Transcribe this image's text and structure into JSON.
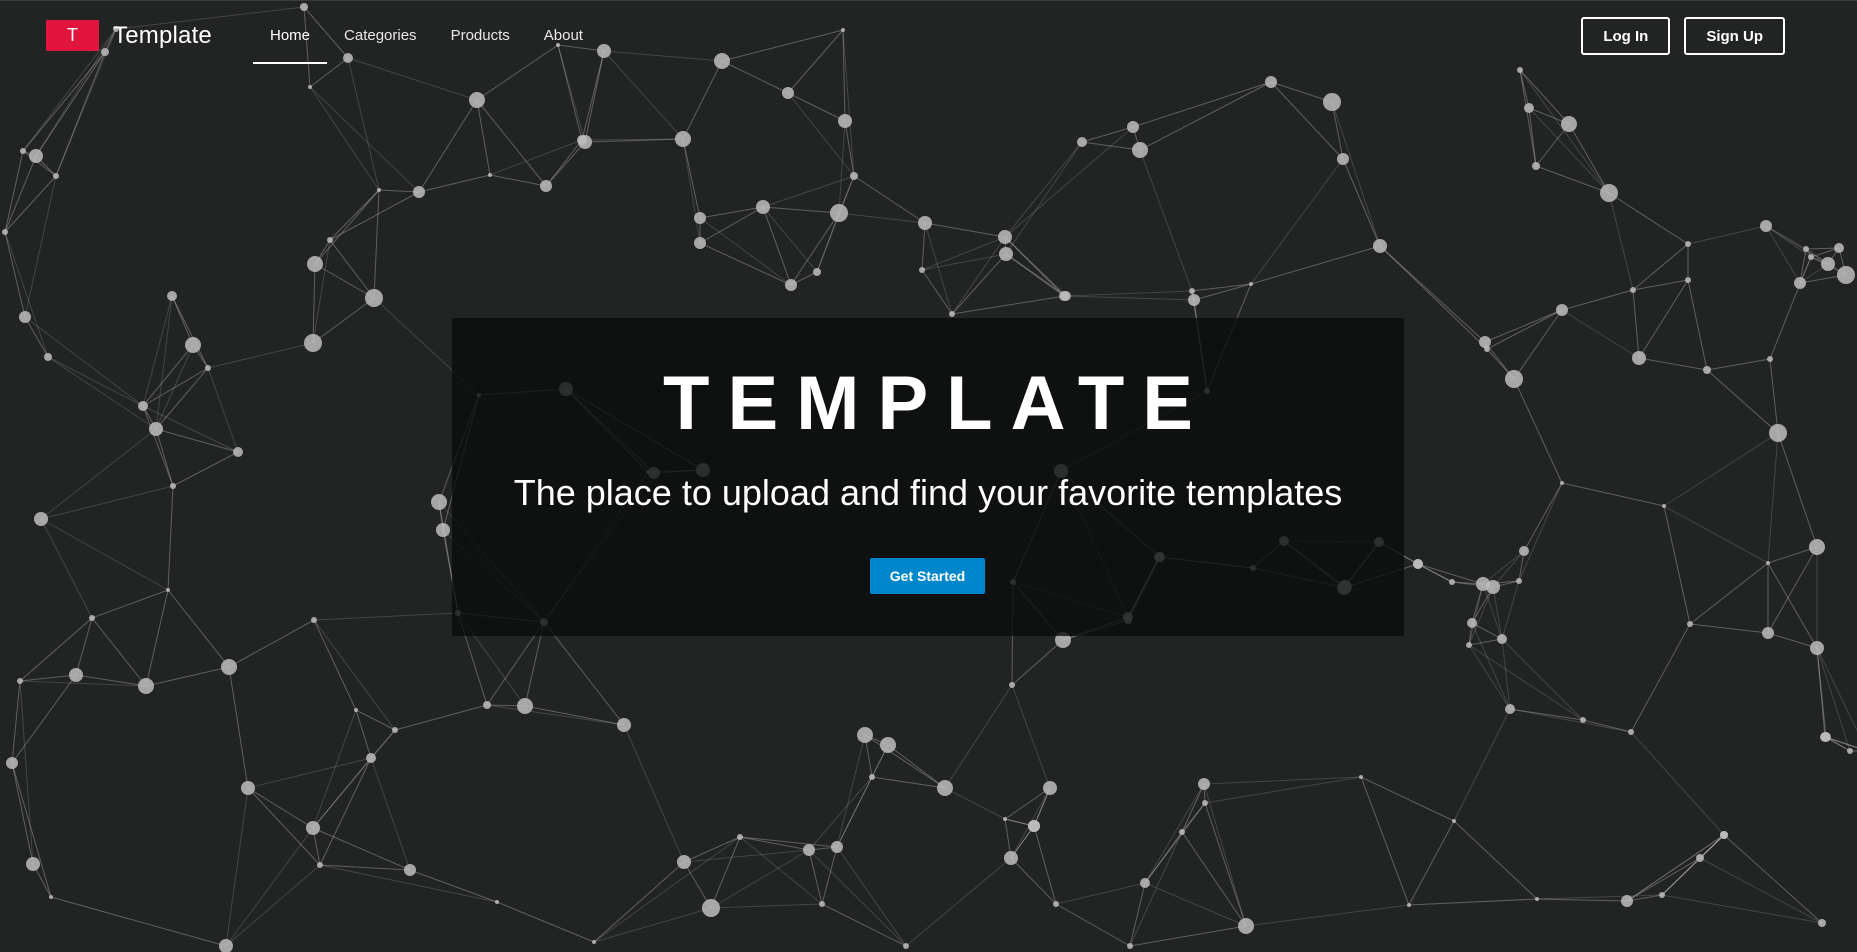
{
  "brand": {
    "logo_letter": "T",
    "name": "Template",
    "logo_color": "#e0143c"
  },
  "nav": {
    "items": [
      {
        "label": "Home",
        "active": true
      },
      {
        "label": "Categories",
        "active": false
      },
      {
        "label": "Products",
        "active": false
      },
      {
        "label": "About",
        "active": false
      }
    ]
  },
  "auth": {
    "login_label": "Log In",
    "signup_label": "Sign Up"
  },
  "hero": {
    "title": "TEMPLATE",
    "subtitle": "The place to upload and find your favorite templates",
    "cta_label": "Get Started",
    "cta_color": "#0086cb"
  },
  "theme": {
    "background": "#222323",
    "network_color": "#bdbdbd"
  }
}
